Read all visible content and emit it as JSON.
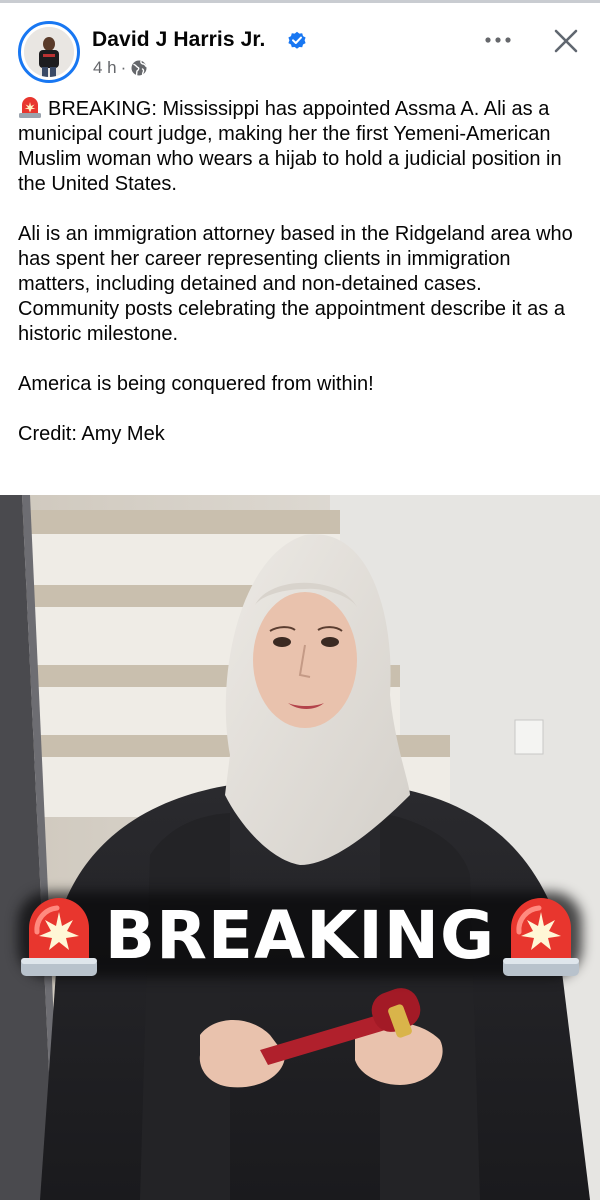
{
  "post": {
    "author_name": "David J Harris Jr.",
    "timestamp": "4 h",
    "separator": "·",
    "paragraphs": {
      "p1": "BREAKING: Mississippi has appointed Assma A. Ali as a municipal court judge, making her the first Yemeni-American Muslim woman who wears a hijab to hold a judicial position in the United States.",
      "p2": "Ali is an immigration attorney based in the Ridgeland area who has spent her career representing clients in immigration matters, including detained and non-detained cases. Community posts celebrating the appointment describe it as a historic milestone.",
      "p3": "America is being conquered from within!",
      "p4": "Credit: Amy Mek"
    }
  },
  "image": {
    "banner_text": "BREAKING"
  },
  "icons": {
    "verified": "verified-badge-icon",
    "privacy": "globe-icon",
    "more": "more-horizontal-icon",
    "close": "close-icon",
    "siren": "police-siren-icon"
  },
  "colors": {
    "verified_blue": "#1877f2",
    "meta_gray": "#65676b",
    "siren_red": "#e8362e"
  }
}
